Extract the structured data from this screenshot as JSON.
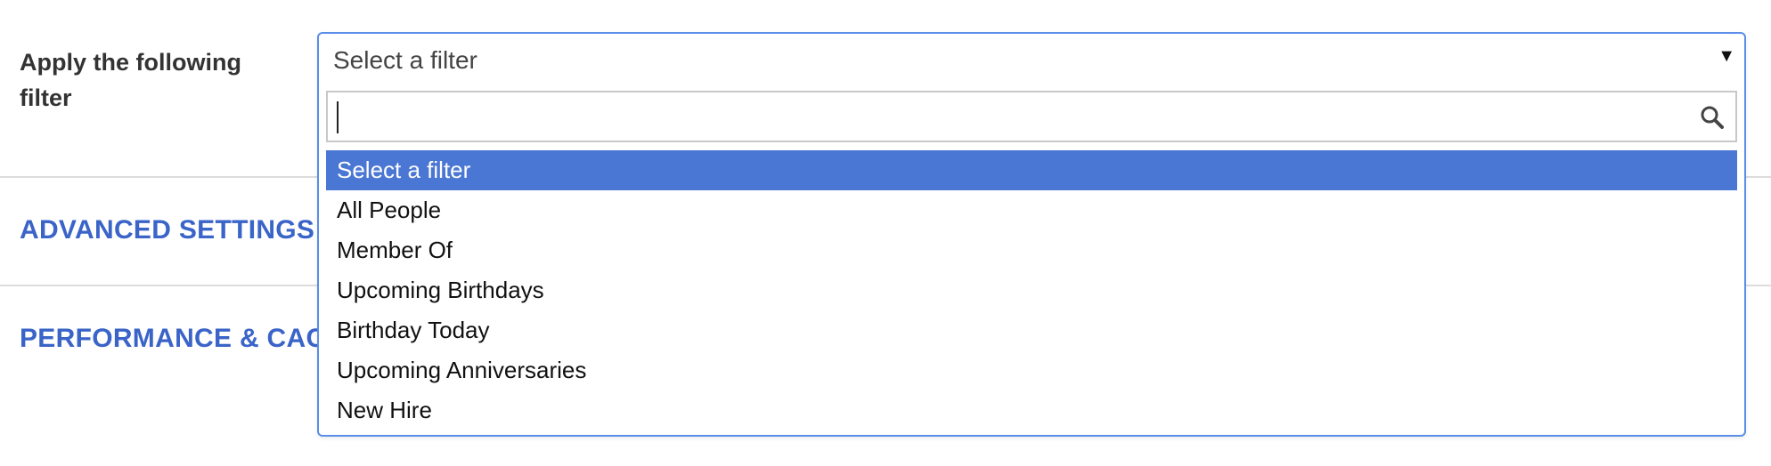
{
  "form": {
    "filter_label": "Apply the following filter"
  },
  "sections": {
    "advanced_settings": "ADVANCED SETTINGS",
    "performance_cache": "PERFORMANCE & CACHE"
  },
  "filter_select": {
    "selected_value": "Select a filter",
    "caret_glyph": "▼",
    "search": {
      "value": "",
      "placeholder": "",
      "icon": "search-icon"
    },
    "options": [
      {
        "label": "Select a filter",
        "highlighted": true
      },
      {
        "label": "All People",
        "highlighted": false
      },
      {
        "label": "Member Of",
        "highlighted": false
      },
      {
        "label": "Upcoming Birthdays",
        "highlighted": false
      },
      {
        "label": "Birthday Today",
        "highlighted": false
      },
      {
        "label": "Upcoming Anniversaries",
        "highlighted": false
      },
      {
        "label": "New Hire",
        "highlighted": false
      }
    ]
  },
  "colors": {
    "accent_blue": "#3a64c8",
    "highlight_bg": "#4a76d4",
    "focus_border": "#5b8ee8"
  }
}
